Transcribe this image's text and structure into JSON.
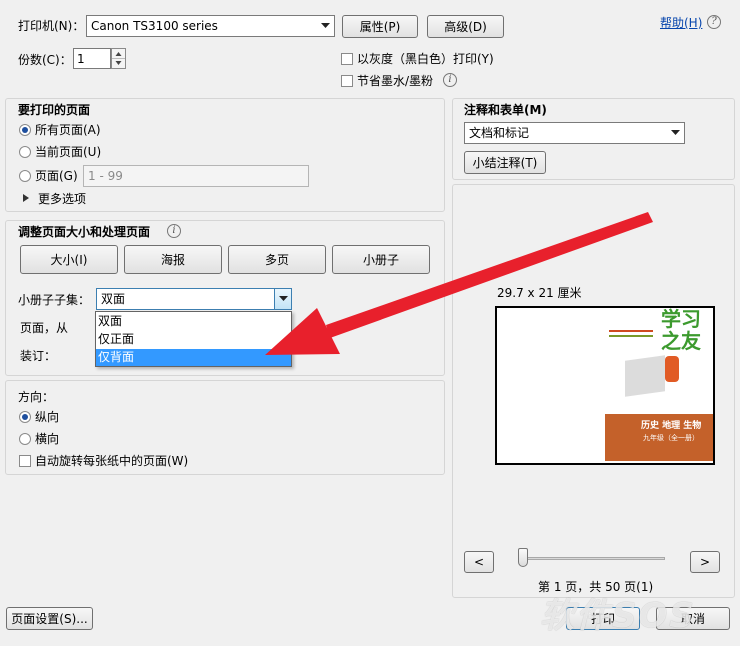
{
  "printer": {
    "label": "打印机(N)：",
    "value": "Canon TS3100 series",
    "properties_button": "属性(P)",
    "advanced_button": "高级(D)",
    "help_link": "帮助(H)"
  },
  "copies": {
    "label": "份数(C)：",
    "value": "1"
  },
  "options": {
    "grayscale": "以灰度（黑白色）打印(Y)",
    "save_ink": "节省墨水/墨粉"
  },
  "pages_to_print": {
    "title": "要打印的页面",
    "all": "所有页面(A)",
    "current": "当前页面(U)",
    "pages": "页面(G)",
    "pages_placeholder": "1 - 99",
    "more": "更多选项"
  },
  "page_sizing": {
    "title": "调整页面大小和处理页面",
    "tabs": [
      "大小(I)",
      "海报",
      "多页",
      "小册子"
    ],
    "booklet_subset_label": "小册子子集：",
    "booklet_subset_value": "双面",
    "pages_from_label": "页面，从",
    "binding_label": "装订：",
    "dropdown_options": [
      "双面",
      "仅正面",
      "仅背面"
    ]
  },
  "orientation": {
    "title": "方向：",
    "portrait": "纵向",
    "landscape": "横向",
    "auto_rotate": "自动旋转每张纸中的页面(W)"
  },
  "comments": {
    "title": "注释和表单(M)",
    "value": "文档和标记",
    "summarize_button": "小结注释(T)"
  },
  "preview": {
    "paper_size": "29.7 x 21 厘米",
    "prev_button": "<",
    "next_button": ">",
    "page_status": "第 1 页，共 50 页(1)",
    "cover": {
      "logo_line1": "学习",
      "logo_line2": "之友",
      "subtitle": "历史 地理 生物",
      "grade": "九年级（全一册）"
    }
  },
  "footer": {
    "page_setup_button": "页面设置(S)...",
    "print_button": "打印",
    "cancel_button": "取消"
  },
  "watermark": "软件SOS",
  "colors": {
    "accent": "#1e4f9e",
    "selection": "#3399ff",
    "arrow_red": "#e8202c",
    "link": "#0645ad"
  }
}
